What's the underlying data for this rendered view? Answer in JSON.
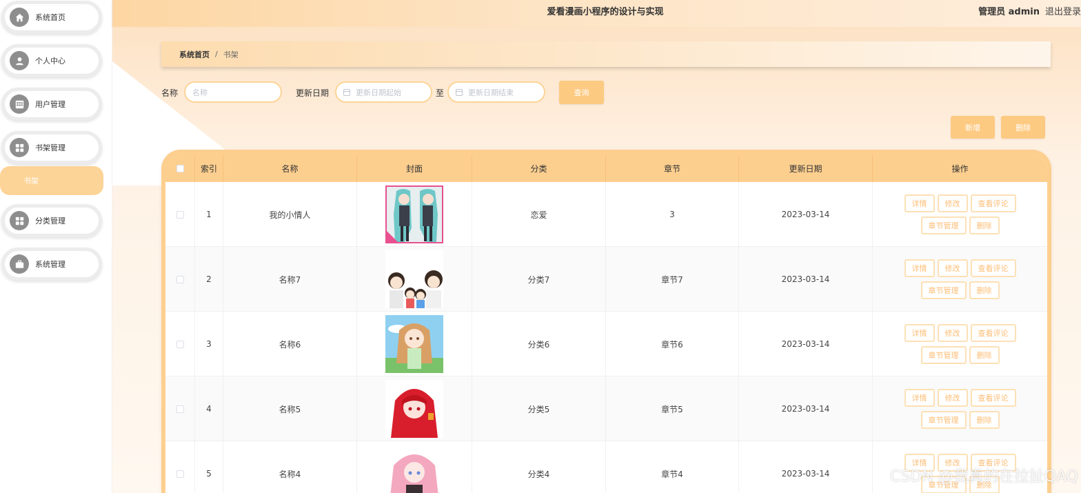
{
  "app": {
    "title": "爱看漫画小程序的设计与实现",
    "user_label": "管理员 admin",
    "logout_label": "退出登录"
  },
  "sidebar": {
    "items": [
      {
        "label": "系统首页",
        "icon": "home-icon"
      },
      {
        "label": "个人中心",
        "icon": "user-icon"
      },
      {
        "label": "用户管理",
        "icon": "grid-icon"
      },
      {
        "label": "书架管理",
        "icon": "apps-icon"
      },
      {
        "label": "分类管理",
        "icon": "apps-icon"
      },
      {
        "label": "系统管理",
        "icon": "briefcase-icon"
      }
    ],
    "sub_item": "书架"
  },
  "breadcrumb": {
    "home": "系统首页",
    "separator": "/",
    "current": "书架"
  },
  "search": {
    "name_label": "名称",
    "name_placeholder": "名称",
    "date_label": "更新日期",
    "date_start_placeholder": "更新日期起始",
    "date_to": "至",
    "date_end_placeholder": "更新日期结束",
    "query_button": "查询"
  },
  "actions": {
    "add_button": "新增",
    "delete_button": "删除"
  },
  "table": {
    "headers": [
      "索引",
      "名称",
      "封面",
      "分类",
      "章节",
      "更新日期",
      "操作"
    ],
    "row_ops": {
      "detail": "详情",
      "edit": "修改",
      "view_comments": "查看评论",
      "chapters": "章节管理",
      "delete": "删除"
    },
    "rows": [
      {
        "index": "1",
        "name": "我的小情人",
        "category": "恋爱",
        "chapter": "3",
        "date": "2023-03-14",
        "cover": "cover-twin-girls"
      },
      {
        "index": "2",
        "name": "名称7",
        "category": "分类7",
        "chapter": "章节7",
        "date": "2023-03-14",
        "cover": "cover-family"
      },
      {
        "index": "3",
        "name": "名称6",
        "category": "分类6",
        "chapter": "章节6",
        "date": "2023-03-14",
        "cover": "cover-girl-sky"
      },
      {
        "index": "4",
        "name": "名称5",
        "category": "分类5",
        "chapter": "章节5",
        "date": "2023-03-14",
        "cover": "cover-red-hair"
      },
      {
        "index": "5",
        "name": "名称4",
        "category": "分类4",
        "chapter": "章节4",
        "date": "2023-03-14",
        "cover": "cover-pink-hair"
      }
    ]
  },
  "watermark": "CSDN @我真的在拉扯QAQ",
  "colors": {
    "accent": "#fdcf8f",
    "accent_button": "#fdca82",
    "op_text": "#fdbd75"
  }
}
